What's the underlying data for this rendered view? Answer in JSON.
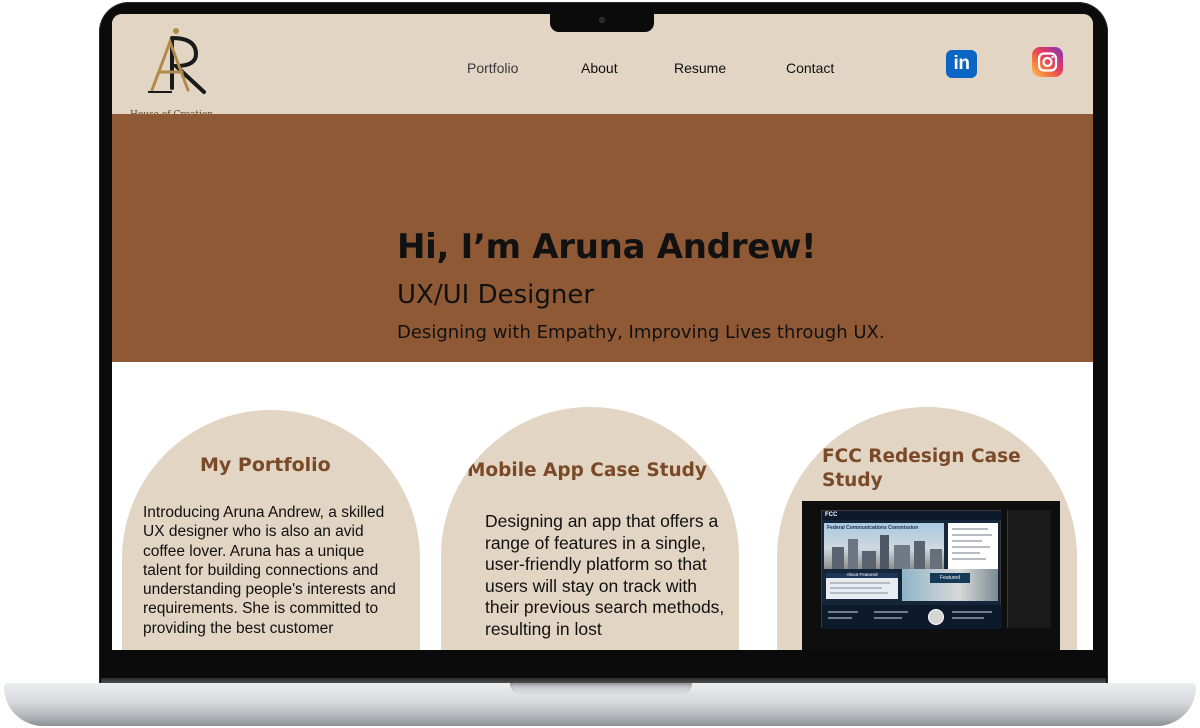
{
  "brand": {
    "logo_initials": "AR",
    "tagline": "House of Creation"
  },
  "nav": {
    "items": [
      {
        "label": "Portfolio"
      },
      {
        "label": "About"
      },
      {
        "label": "Resume"
      },
      {
        "label": "Contact"
      }
    ]
  },
  "social": {
    "linkedin_label": "in",
    "linkedin_icon": "linkedin-icon",
    "instagram_icon": "instagram-icon"
  },
  "hero": {
    "heading": "Hi, I’m Aruna Andrew!",
    "role": "UX/UI Designer",
    "tagline": "Designing with Empathy, Improving Lives through UX."
  },
  "cards": [
    {
      "title": "My Portfolio",
      "body": "Introducing Aruna Andrew, a skilled UX designer who is also an avid coffee lover. Aruna has a unique talent for building connections and understanding people's interests and requirements. She is committed to providing the best customer"
    },
    {
      "title": "Mobile App Case Study",
      "body": "Designing an app that offers a range of features in a single, user-friendly platform so that users will stay on track with their previous search methods, resulting in lost"
    },
    {
      "title": "FCC Redesign Case Study",
      "thumbnail": {
        "logo": "FCC",
        "hero_title": "Federal Communications Commission",
        "featured_label": "About Featured",
        "photo_tag": "Featured"
      }
    }
  ],
  "colors": {
    "header_bg": "#e2d5c3",
    "hero_bg": "#8f5936",
    "card_bg": "#e2d5c3",
    "card_title": "#7a4a28",
    "linkedin_blue": "#0a66c2"
  }
}
